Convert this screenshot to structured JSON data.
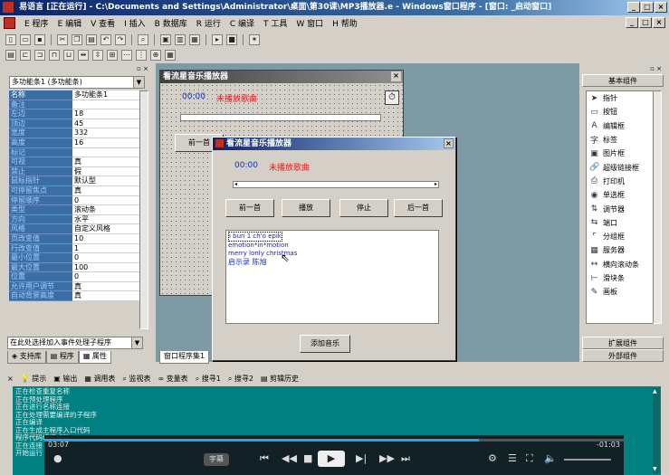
{
  "window": {
    "title": "易语言 [正在运行] - C:\\Documents and Settings\\Administrator\\桌面\\第30课\\MP3播放器.e - Windows窗口程序 - [窗口: _启动窗口]",
    "controls": [
      "_",
      "□",
      "×"
    ]
  },
  "menu": [
    "E 程序",
    "E 编辑",
    "V 查看",
    "I 插入",
    "B 数据库",
    "R 运行",
    "C 编译",
    "T 工具",
    "W 窗口",
    "H 帮助"
  ],
  "mdi_controls": [
    "_",
    "□",
    "×"
  ],
  "left_panel": {
    "component_combo": "多功能条1 (多功能条)",
    "properties": [
      {
        "name": "名称",
        "value": "多功能条1"
      },
      {
        "name": "备注",
        "value": ""
      },
      {
        "name": "左边",
        "value": "18"
      },
      {
        "name": "顶边",
        "value": "45"
      },
      {
        "name": "宽度",
        "value": "332"
      },
      {
        "name": "高度",
        "value": "16"
      },
      {
        "name": "标记",
        "value": ""
      },
      {
        "name": "可视",
        "value": "真"
      },
      {
        "name": "禁止",
        "value": "假"
      },
      {
        "name": "鼠标指针",
        "value": "默认型"
      },
      {
        "name": "可停留焦点",
        "value": "真"
      },
      {
        "name": "停留顺序",
        "value": "0"
      },
      {
        "name": "类型",
        "value": "滚动条"
      },
      {
        "name": "方向",
        "value": "水平"
      },
      {
        "name": "风格",
        "value": "自定义风格"
      },
      {
        "name": "页改变值",
        "value": "10"
      },
      {
        "name": "行改变值",
        "value": "1"
      },
      {
        "name": "最小位置",
        "value": "0"
      },
      {
        "name": "最大位置",
        "value": "100"
      },
      {
        "name": "位置",
        "value": "0"
      },
      {
        "name": "允许用户调节",
        "value": "真"
      },
      {
        "name": "自动背景高度",
        "value": "真"
      }
    ],
    "event_combo": "在此处选择加入事件处理子程序",
    "tabs": [
      "支持库",
      "程序",
      "属性"
    ],
    "design_tab": "窗口程序集1"
  },
  "design_window": {
    "title": "看流星音乐播放器",
    "time": "00:00",
    "status": "未播放歌曲",
    "prev_label": "前一首"
  },
  "running_window": {
    "title": "看流星音乐播放器",
    "time": "00:00",
    "status": "未播放歌曲",
    "buttons": [
      "前一首",
      "播放",
      "停止",
      "后一首"
    ],
    "lyrics": [
      "i bun 1 ch'o epik",
      "emotion*in*motion",
      "merry lonly christmas"
    ],
    "lyric_highlight": "启示录 陈旭",
    "add_button": "添加音乐"
  },
  "right_panel": {
    "header": "基本组件",
    "items": [
      {
        "icon": "pointer-icon",
        "glyph": "➤",
        "label": "指针"
      },
      {
        "icon": "button-icon",
        "glyph": "▭",
        "label": "按钮"
      },
      {
        "icon": "editbox-icon",
        "glyph": "A",
        "label": "编辑框"
      },
      {
        "icon": "label-icon",
        "glyph": "字",
        "label": "标签"
      },
      {
        "icon": "picturebox-icon",
        "glyph": "▣",
        "label": "图片框"
      },
      {
        "icon": "hyperlink-icon",
        "glyph": "🔗",
        "label": "超级链接框"
      },
      {
        "icon": "printer-icon",
        "glyph": "⎙",
        "label": "打印机"
      },
      {
        "icon": "radio-icon",
        "glyph": "◉",
        "label": "单选框"
      },
      {
        "icon": "adjuster-icon",
        "glyph": "⇅",
        "label": "调节器"
      },
      {
        "icon": "port-icon",
        "glyph": "⇆",
        "label": "端口"
      },
      {
        "icon": "groupbox-icon",
        "glyph": "⌜",
        "label": "分组框"
      },
      {
        "icon": "server-icon",
        "glyph": "▦",
        "label": "服务器"
      },
      {
        "icon": "hscroll-icon",
        "glyph": "↔",
        "label": "横向滚动条"
      },
      {
        "icon": "slider-icon",
        "glyph": "⊢",
        "label": "滑块条"
      },
      {
        "icon": "palette-icon",
        "glyph": "✎",
        "label": "画板"
      }
    ],
    "ext_label": "扩展组件",
    "ext2_label": "外部组件"
  },
  "output": {
    "tabs": [
      "提示",
      "输出",
      "调用表",
      "监视表",
      "变量表",
      "搜寻1",
      "搜寻2",
      "剪辑历史"
    ],
    "lines": [
      "正在检查重复名称",
      "正在预处理程序",
      "正在进行名称连接",
      "正在处理需要编译的子程序",
      "正在编译",
      "正在生成主程序入口代码",
      "程序代码编译成功",
      "正在连接",
      "开始运行"
    ]
  },
  "media_player": {
    "elapsed": "03:07",
    "remaining": "-01:03",
    "progress": 0.75,
    "subtitle_label": "字幕"
  }
}
